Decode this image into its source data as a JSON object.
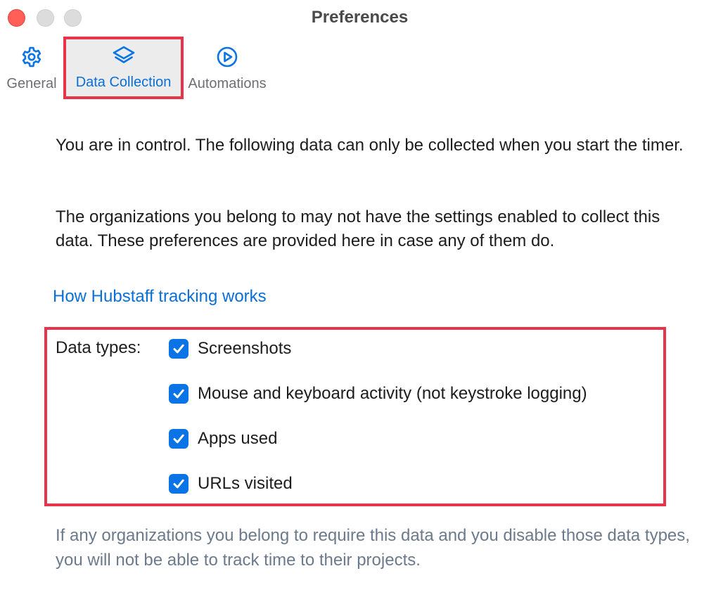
{
  "window": {
    "title": "Preferences"
  },
  "toolbar": {
    "tabs": [
      {
        "label": "General",
        "icon": "gear-icon",
        "selected": false
      },
      {
        "label": "Data Collection",
        "icon": "layers-icon",
        "selected": true
      },
      {
        "label": "Automations",
        "icon": "play-circle-icon",
        "selected": false
      }
    ]
  },
  "content": {
    "intro": "You are in control. The following data can only be collected when you start the timer.",
    "orgs_note": "The organizations you belong to may not have the settings enabled to collect this data. These preferences are provided here in case any of them do.",
    "help_link": "How Hubstaff tracking works",
    "data_types_label": "Data types:",
    "data_types": [
      {
        "label": "Screenshots",
        "checked": true
      },
      {
        "label": "Mouse and keyboard activity (not keystroke logging)",
        "checked": true
      },
      {
        "label": "Apps used",
        "checked": true
      },
      {
        "label": "URLs visited",
        "checked": true
      }
    ],
    "footnote": "If any organizations you belong to require this data and you disable those data types, you will not be able to track time to their projects."
  },
  "colors": {
    "accent": "#0a73e6",
    "link": "#0a6fd6",
    "highlight_border": "#e8344a",
    "close_button": "#ff5f57",
    "muted_text": "#6b7a8c"
  }
}
